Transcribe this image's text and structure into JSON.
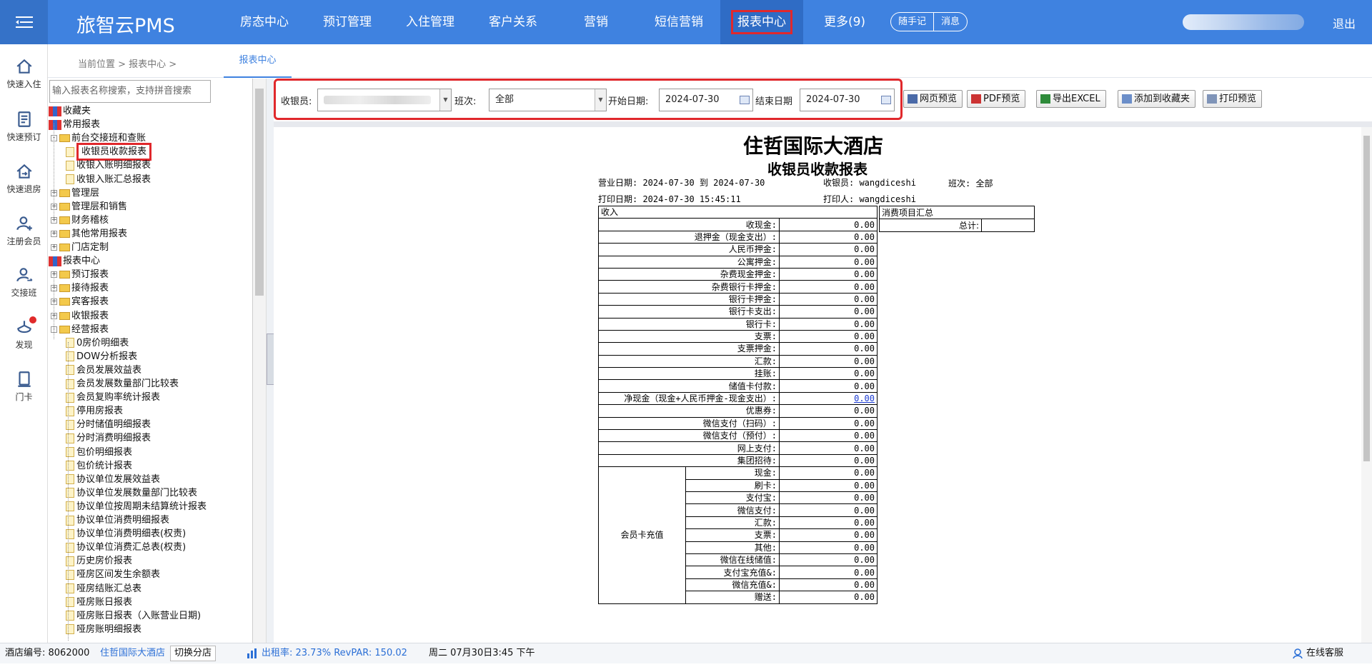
{
  "topbar": {
    "brand": "旅智云PMS",
    "nav": [
      "房态中心",
      "预订管理",
      "入住管理",
      "客户关系",
      "营销",
      "短信营销",
      "报表中心",
      "更多(9)"
    ],
    "active_nav": "报表中心",
    "pill": [
      "随手记",
      "消息"
    ],
    "logout": "退出"
  },
  "sidenav": [
    {
      "icon": "home-icon",
      "label": "快速入住"
    },
    {
      "icon": "book-icon",
      "label": "快速预订"
    },
    {
      "icon": "checkout-icon",
      "label": "快速退房"
    },
    {
      "icon": "add-user-icon",
      "label": "注册会员"
    },
    {
      "icon": "shift-icon",
      "label": "交接班"
    },
    {
      "icon": "discover-icon",
      "label": "发现"
    },
    {
      "icon": "card-icon",
      "label": "门卡"
    }
  ],
  "breadcrumb": {
    "text": "当前位置 > 报表中心 >",
    "tab": "报表中心"
  },
  "tree": {
    "search_placeholder": "输入报表名称搜索，支持拼音搜索",
    "nodes": [
      {
        "t": "收藏夹",
        "kind": "books",
        "lvl": 0
      },
      {
        "t": "常用报表",
        "kind": "books",
        "lvl": 0
      },
      {
        "t": "前台交接班和查账",
        "kind": "folder-open",
        "lvl": 1,
        "exp": "-"
      },
      {
        "t": "收银员收款报表",
        "kind": "page",
        "lvl": 2,
        "hl": true
      },
      {
        "t": "收银入账明细报表",
        "kind": "page",
        "lvl": 2
      },
      {
        "t": "收银入账汇总报表",
        "kind": "page",
        "lvl": 2
      },
      {
        "t": "管理层",
        "kind": "folder",
        "lvl": 1,
        "exp": "+"
      },
      {
        "t": "管理层和销售",
        "kind": "folder",
        "lvl": 1,
        "exp": "+"
      },
      {
        "t": "财务稽核",
        "kind": "folder",
        "lvl": 1,
        "exp": "+"
      },
      {
        "t": "其他常用报表",
        "kind": "folder",
        "lvl": 1,
        "exp": "+"
      },
      {
        "t": "门店定制",
        "kind": "folder",
        "lvl": 1,
        "exp": "+"
      },
      {
        "t": "报表中心",
        "kind": "books",
        "lvl": 0
      },
      {
        "t": "预订报表",
        "kind": "folder",
        "lvl": 1,
        "exp": "+"
      },
      {
        "t": "接待报表",
        "kind": "folder",
        "lvl": 1,
        "exp": "+"
      },
      {
        "t": "宾客报表",
        "kind": "folder",
        "lvl": 1,
        "exp": "+"
      },
      {
        "t": "收银报表",
        "kind": "folder",
        "lvl": 1,
        "exp": "+"
      },
      {
        "t": "经营报表",
        "kind": "folder-open",
        "lvl": 1,
        "exp": "-"
      },
      {
        "t": "0房价明细表",
        "kind": "page",
        "lvl": 2
      },
      {
        "t": "DOW分析报表",
        "kind": "page",
        "lvl": 2
      },
      {
        "t": "会员发展效益表",
        "kind": "page",
        "lvl": 2
      },
      {
        "t": "会员发展数量部门比较表",
        "kind": "page",
        "lvl": 2
      },
      {
        "t": "会员复购率统计报表",
        "kind": "page",
        "lvl": 2
      },
      {
        "t": "停用房报表",
        "kind": "page",
        "lvl": 2
      },
      {
        "t": "分时储值明细报表",
        "kind": "page",
        "lvl": 2
      },
      {
        "t": "分时消费明细报表",
        "kind": "page",
        "lvl": 2
      },
      {
        "t": "包价明细报表",
        "kind": "page",
        "lvl": 2
      },
      {
        "t": "包价统计报表",
        "kind": "page",
        "lvl": 2
      },
      {
        "t": "协议单位发展效益表",
        "kind": "page",
        "lvl": 2
      },
      {
        "t": "协议单位发展数量部门比较表",
        "kind": "page",
        "lvl": 2
      },
      {
        "t": "协议单位按周期未结算统计报表",
        "kind": "page",
        "lvl": 2
      },
      {
        "t": "协议单位消费明细报表",
        "kind": "page",
        "lvl": 2
      },
      {
        "t": "协议单位消费明细表(权责)",
        "kind": "page",
        "lvl": 2
      },
      {
        "t": "协议单位消费汇总表(权责)",
        "kind": "page",
        "lvl": 2
      },
      {
        "t": "历史房价报表",
        "kind": "page",
        "lvl": 2
      },
      {
        "t": "哑房区间发生余额表",
        "kind": "page",
        "lvl": 2
      },
      {
        "t": "哑房结账汇总表",
        "kind": "page",
        "lvl": 2
      },
      {
        "t": "哑房账日报表",
        "kind": "page",
        "lvl": 2
      },
      {
        "t": "哑房账日报表（入账营业日期)",
        "kind": "page",
        "lvl": 2
      },
      {
        "t": "哑房账明细报表",
        "kind": "page",
        "lvl": 2
      }
    ]
  },
  "filters": {
    "cashier_label": "收银员:",
    "shift_label": "班次:",
    "shift_value": "全部",
    "start_label": "开始日期:",
    "start_value": "2024-07-30",
    "end_label": "结束日期",
    "end_value": "2024-07-30"
  },
  "buttons": [
    "网页预览",
    "PDF预览",
    "导出EXCEL",
    "添加到收藏夹",
    "打印预览"
  ],
  "report": {
    "hotel": "住哲国际大酒店",
    "title": "收银员收款报表",
    "meta": {
      "biz_date": "营业日期: 2024-07-30 到 2024-07-30",
      "cashier": "收银员: wangdiceshi",
      "shift": "班次: 全部",
      "print_date": "打印日期: 2024-07-30 15:45:11",
      "printer": "打印人: wangdiceshi"
    },
    "income_header": "收入",
    "rows": [
      [
        "收现金:",
        "0.00"
      ],
      [
        "退押金（现金支出）:",
        "0.00"
      ],
      [
        "人民币押金:",
        "0.00"
      ],
      [
        "公寓押金:",
        "0.00"
      ],
      [
        "杂费现金押金:",
        "0.00"
      ],
      [
        "杂费银行卡押金:",
        "0.00"
      ],
      [
        "银行卡押金:",
        "0.00"
      ],
      [
        "银行卡支出:",
        "0.00"
      ],
      [
        "银行卡:",
        "0.00"
      ],
      [
        "支票:",
        "0.00"
      ],
      [
        "支票押金:",
        "0.00"
      ],
      [
        "汇款:",
        "0.00"
      ],
      [
        "挂账:",
        "0.00"
      ],
      [
        "储值卡付款:",
        "0.00"
      ],
      [
        "净现金（现金+人民币押金-现金支出）:",
        "0.00"
      ],
      [
        "优惠券:",
        "0.00"
      ],
      [
        "微信支付（扫码）:",
        "0.00"
      ],
      [
        "微信支付（预付）:",
        "0.00"
      ],
      [
        "网上支付:",
        "0.00"
      ],
      [
        "集团招待:",
        "0.00"
      ]
    ],
    "member_group": "会员卡充值",
    "member_rows": [
      [
        "现金:",
        "0.00"
      ],
      [
        "刷卡:",
        "0.00"
      ],
      [
        "支付宝:",
        "0.00"
      ],
      [
        "微信支付:",
        "0.00"
      ],
      [
        "汇款:",
        "0.00"
      ],
      [
        "支票:",
        "0.00"
      ],
      [
        "其他:",
        "0.00"
      ],
      [
        "微信在线储值:",
        "0.00"
      ],
      [
        "支付宝充值&:",
        "0.00"
      ],
      [
        "微信充值&:",
        "0.00"
      ],
      [
        "赠送:",
        "0.00"
      ]
    ],
    "summary_header": "消费项目汇总",
    "summary_total": "总计:"
  },
  "status": {
    "hotel_no": "酒店编号: 8062000",
    "hotel_name": "住哲国际大酒店",
    "switch": "切换分店",
    "occupancy": "出租率: 23.73% RevPAR: 150.02",
    "datetime": "周二 07月30日3:45 下午",
    "service": "在线客服"
  }
}
